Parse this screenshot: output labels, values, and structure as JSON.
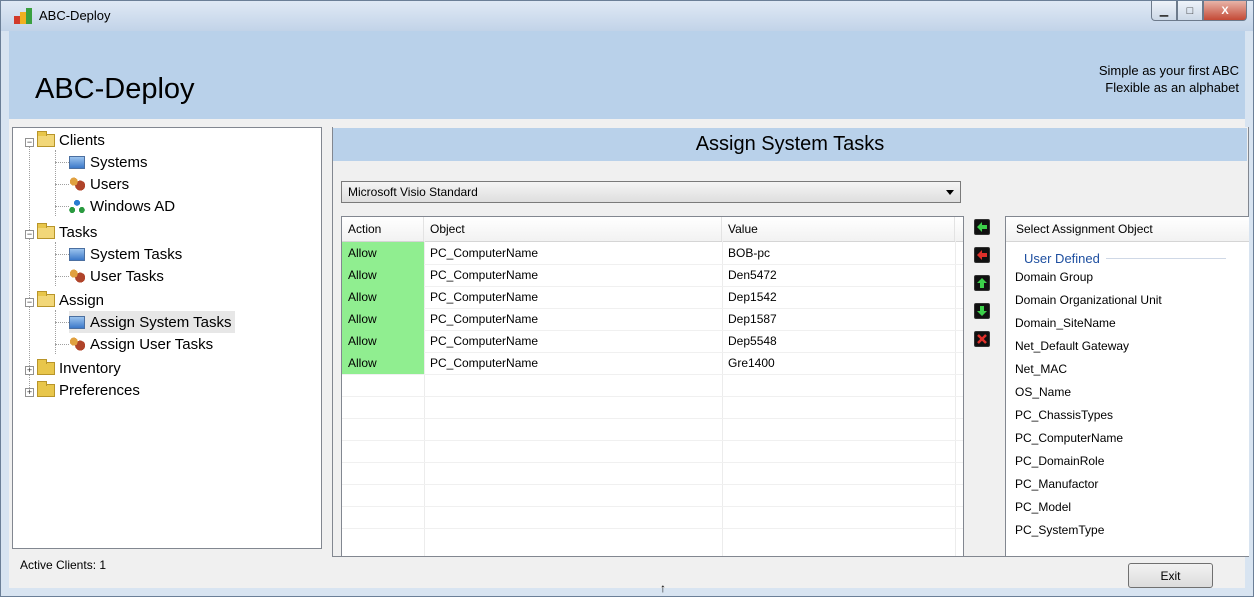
{
  "window": {
    "title": "ABC-Deploy"
  },
  "banner": {
    "app_title": "ABC-Deploy",
    "slogan_line1": "Simple as your first ABC",
    "slogan_line2": "Flexible as an alphabet"
  },
  "tree": {
    "clients": "Clients",
    "systems": "Systems",
    "users": "Users",
    "windows_ad": "Windows AD",
    "tasks": "Tasks",
    "system_tasks": "System Tasks",
    "user_tasks": "User Tasks",
    "assign": "Assign",
    "assign_system_tasks": "Assign System Tasks",
    "assign_user_tasks": "Assign User Tasks",
    "inventory": "Inventory",
    "preferences": "Preferences"
  },
  "status": {
    "text": "Active Clients: 1"
  },
  "panel": {
    "title": "Assign System Tasks",
    "combo_value": "Microsoft Visio Standard"
  },
  "grid": {
    "headers": {
      "action": "Action",
      "object": "Object",
      "value": "Value"
    },
    "rows": [
      {
        "action": "Allow",
        "object": "PC_ComputerName",
        "value": "BOB-pc"
      },
      {
        "action": "Allow",
        "object": "PC_ComputerName",
        "value": "Den5472"
      },
      {
        "action": "Allow",
        "object": "PC_ComputerName",
        "value": "Dep1542"
      },
      {
        "action": "Allow",
        "object": "PC_ComputerName",
        "value": "Dep1587"
      },
      {
        "action": "Allow",
        "object": "PC_ComputerName",
        "value": "Dep5548"
      },
      {
        "action": "Allow",
        "object": "PC_ComputerName",
        "value": "Gre1400"
      }
    ]
  },
  "objects": {
    "header": "Select Assignment Object",
    "group": "User Defined",
    "items": [
      "Domain Group",
      "Domain Organizational Unit",
      "Domain_SiteName",
      "Net_Default Gateway",
      "Net_MAC",
      "OS_Name",
      "PC_ChassisTypes",
      "PC_ComputerName",
      "PC_DomainRole",
      "PC_Manufactor",
      "PC_Model",
      "PC_SystemType"
    ]
  },
  "buttons": {
    "exit": "Exit"
  },
  "colors": {
    "banner": "#b9d1ea",
    "allow": "#90ee90"
  }
}
